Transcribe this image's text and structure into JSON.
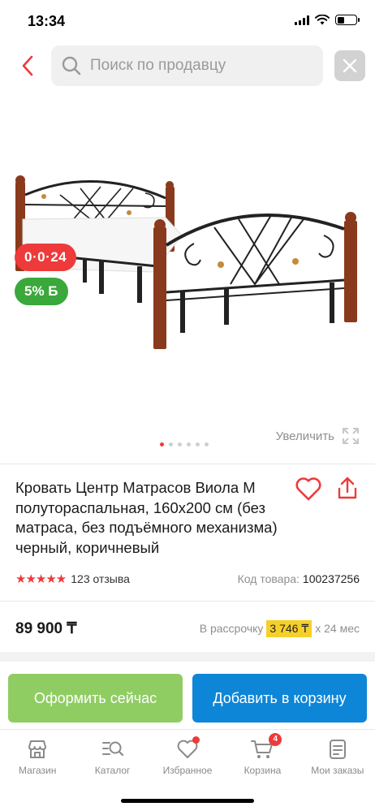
{
  "status_bar": {
    "time": "13:34"
  },
  "search": {
    "placeholder": "Поиск по продавцу"
  },
  "gallery": {
    "timer_badge": "0·0·24",
    "bonus_badge": "5% Б",
    "zoom_label": "Увеличить",
    "images_count": 6,
    "current_image": 1
  },
  "product": {
    "title": "Кровать Центр Матрасов Виола М полутораспальная, 160x200 см (без матраса, без подъёмного механизма) черный, коричневый",
    "rating_stars": 5,
    "reviews": "123 отзыва",
    "code_label": "Код товара:",
    "code_value": "100237256",
    "price": "89 900 ₸",
    "installment_label": "В рассрочку",
    "installment_amount": "3 746 ₸",
    "installment_term": "x 24 мес"
  },
  "actions": {
    "checkout": "Оформить сейчас",
    "add_to_cart": "Добавить в корзину"
  },
  "nav": {
    "items": [
      {
        "label": "Магазин",
        "icon": "shop-icon"
      },
      {
        "label": "Каталог",
        "icon": "catalog-search-icon"
      },
      {
        "label": "Избранное",
        "icon": "heart-icon"
      },
      {
        "label": "Корзина",
        "icon": "cart-icon",
        "badge": "4"
      },
      {
        "label": "Мои заказы",
        "icon": "orders-icon"
      }
    ]
  },
  "colors": {
    "accent": "#ee3a3a",
    "green": "#8fcd62",
    "blue": "#0d86d8",
    "badge_green": "#3aa83a"
  }
}
